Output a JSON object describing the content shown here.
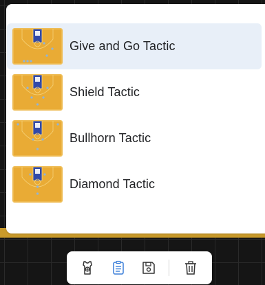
{
  "tactics": [
    {
      "label": "Give and Go Tactic",
      "selected": true
    },
    {
      "label": "Shield Tactic",
      "selected": false
    },
    {
      "label": "Bullhorn Tactic",
      "selected": false
    },
    {
      "label": "Diamond Tactic",
      "selected": false
    }
  ],
  "toolbar": {
    "items": [
      {
        "icon": "jersey-icon"
      },
      {
        "icon": "clipboard-icon",
        "active": true
      },
      {
        "icon": "save-icon"
      },
      {
        "icon": "trash-icon"
      }
    ]
  },
  "colors": {
    "court": "#e9ab35",
    "key": "#3149a8",
    "selected_row": "#e8eff8",
    "active_icon": "#3b7fd9",
    "icon": "#333333"
  }
}
